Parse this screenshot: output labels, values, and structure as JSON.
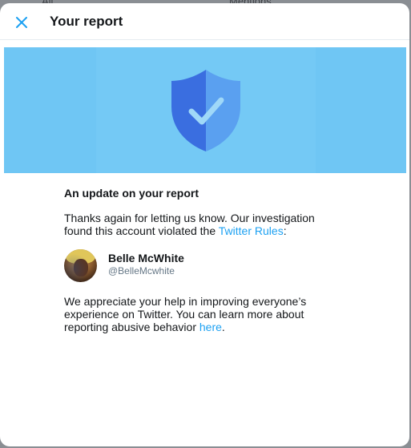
{
  "background": {
    "tab_all": "All",
    "tab_mentions": "Mentions"
  },
  "header": {
    "title": "Your report",
    "close_icon": "close-icon"
  },
  "banner": {
    "icon": "shield-check-icon",
    "colors": {
      "background": "#6fc6f4",
      "shield_dark": "#3a6ee0",
      "shield_light": "#5aa0f0"
    }
  },
  "content": {
    "heading": "An update on your report",
    "p1_text": "Thanks again for letting us know. Our investigation found this account violated the ",
    "p1_link": "Twitter Rules",
    "p1_end": ":",
    "account": {
      "name": "Belle McWhite",
      "handle": "@BelleMcwhite"
    },
    "p2_text": "We appreciate your help in improving everyone’s experience on Twitter. You can learn more about reporting abusive behavior ",
    "p2_link": "here",
    "p2_end": "."
  },
  "colors": {
    "accent": "#1da1f2",
    "text": "#14171a",
    "secondary_text": "#657786"
  }
}
